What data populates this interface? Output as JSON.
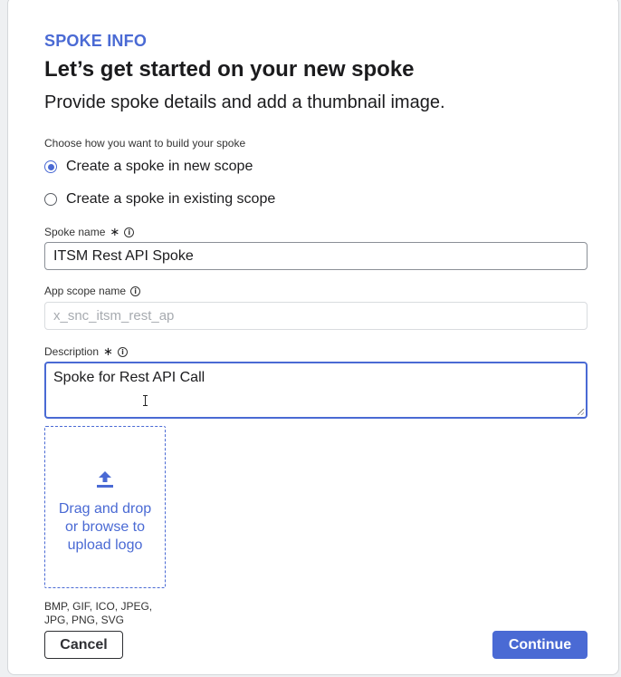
{
  "header": {
    "eyebrow": "SPOKE INFO",
    "title": "Let’s get started on your new spoke",
    "subtitle": "Provide spoke details and add a thumbnail image."
  },
  "build_choice": {
    "label": "Choose how you want to build your spoke",
    "options": [
      {
        "label": "Create a spoke in new scope",
        "selected": true
      },
      {
        "label": "Create a spoke in existing scope",
        "selected": false
      }
    ]
  },
  "fields": {
    "spoke_name": {
      "label": "Spoke name",
      "required_marker": "∗",
      "value": "ITSM Rest API Spoke"
    },
    "app_scope_name": {
      "label": "App scope name",
      "value": "x_snc_itsm_rest_ap"
    },
    "description": {
      "label": "Description",
      "required_marker": "∗",
      "value": "Spoke for Rest API Call"
    }
  },
  "upload": {
    "text": "Drag and drop or browse to upload logo",
    "icon": "upload-icon",
    "formats": "BMP, GIF, ICO, JPEG, JPG, PNG, SVG"
  },
  "footer": {
    "cancel_label": "Cancel",
    "continue_label": "Continue"
  },
  "colors": {
    "accent": "#4a6ad4",
    "text": "#1b1b1d",
    "border": "#8a8f96"
  }
}
